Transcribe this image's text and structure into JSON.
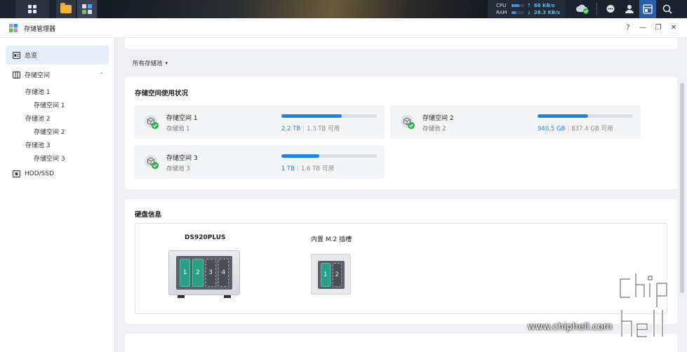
{
  "taskbar": {
    "cpu_label": "CPU",
    "ram_label": "RAM",
    "cpu_value": "66 KB/s",
    "ram_value": "28.3 KB/s",
    "cpu_percent": 60,
    "ram_percent": 35
  },
  "window": {
    "title": "存储管理器",
    "help": "?",
    "minimize": "—",
    "restore": "❐",
    "close": "✕"
  },
  "sidebar": {
    "overview": "总览",
    "storage": "存储空间",
    "pool1": "存储池 1",
    "vol1": "存储空间 1",
    "pool2": "存储池 2",
    "vol2": "存储空间 2",
    "pool3": "存储池 3",
    "vol3": "存储空间 3",
    "hdd": "HDD/SSD"
  },
  "main": {
    "pool_filter": "所有存储池",
    "usage_title": "存储空间使用状况",
    "volumes": [
      {
        "name": "存储空间 1",
        "pool": "存储池 1",
        "used": "2.2 TB",
        "free": "1.3 TB 可用",
        "percent": 63
      },
      {
        "name": "存储空间 2",
        "pool": "存储池 2",
        "used": "940.5 GB",
        "free": "837.4 GB 可用",
        "percent": 53
      },
      {
        "name": "存储空间 3",
        "pool": "存储池 3",
        "used": "1 TB",
        "free": "1.6 TB 可用",
        "percent": 40
      }
    ],
    "disk_title": "硬盘信息",
    "model": "DS920PLUS",
    "bays": [
      "1",
      "2",
      "3",
      "4"
    ],
    "m2_title": "内置 M.2 插槽",
    "m2_slots": [
      "1",
      "2"
    ]
  },
  "watermark": {
    "url": "www.chiphell.com",
    "logo_text": "chip hell"
  }
}
